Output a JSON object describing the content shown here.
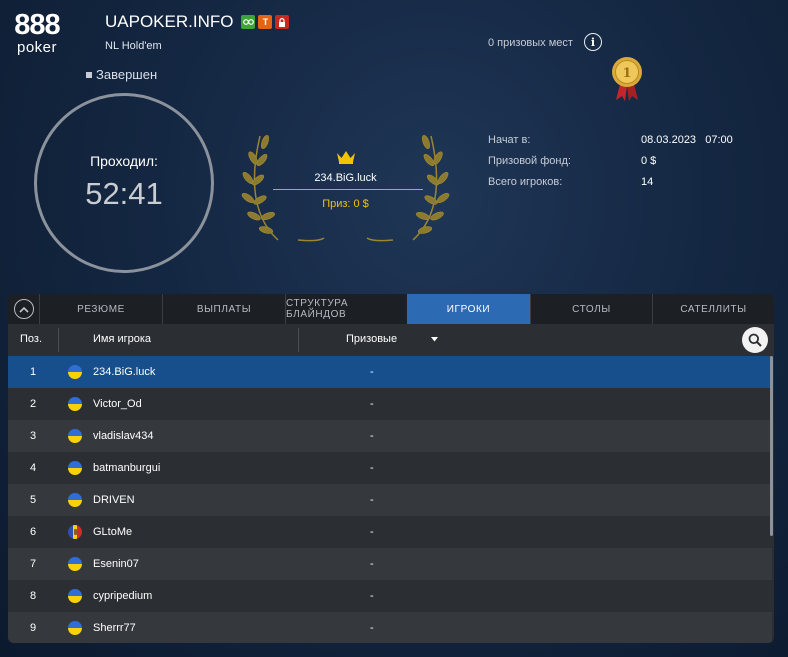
{
  "brand": {
    "logo_top": "888",
    "logo_bottom": "poker"
  },
  "header": {
    "title": "UAPOKER.INFO",
    "badges": [
      "icon-glasses",
      "Т",
      "lock-icon"
    ],
    "game_type": "NL Hold'em",
    "status": "Завершен"
  },
  "timer": {
    "label": "Проходил:",
    "value": "52:41"
  },
  "winner": {
    "name": "234.BiG.luck",
    "prize": "Приз: 0 $"
  },
  "prize_places": "0 призовых мест",
  "details": {
    "started_label": "Начат в:",
    "started_value": "08.03.2023   07:00",
    "prize_pool_label": "Призовой фонд:",
    "prize_pool_value": "0 $",
    "total_players_label": "Всего игроков:",
    "total_players_value": "14"
  },
  "tabs": [
    {
      "label": "РЕЗЮМЕ",
      "active": false
    },
    {
      "label": "ВЫПЛАТЫ",
      "active": false
    },
    {
      "label": "СТРУКТУРА БЛАЙНДОВ",
      "active": false
    },
    {
      "label": "ИГРОКИ",
      "active": true
    },
    {
      "label": "СТОЛЫ",
      "active": false
    },
    {
      "label": "САТЕЛЛИТЫ",
      "active": false
    }
  ],
  "table": {
    "col_pos": "Поз.",
    "col_name": "Имя игрока",
    "col_prize": "Призовые",
    "rows": [
      {
        "pos": "1",
        "flag": "ua",
        "name": "234.BiG.luck",
        "prize": "-"
      },
      {
        "pos": "2",
        "flag": "ua",
        "name": "Victor_Od",
        "prize": "-"
      },
      {
        "pos": "3",
        "flag": "ua",
        "name": "vladislav434",
        "prize": "-"
      },
      {
        "pos": "4",
        "flag": "ua",
        "name": "batmanburgui",
        "prize": "-"
      },
      {
        "pos": "5",
        "flag": "ua",
        "name": "DRIVEN",
        "prize": "-"
      },
      {
        "pos": "6",
        "flag": "md",
        "name": "GLtoMe",
        "prize": "-"
      },
      {
        "pos": "7",
        "flag": "ua",
        "name": "Esenin07",
        "prize": "-"
      },
      {
        "pos": "8",
        "flag": "ua",
        "name": "cypripedium",
        "prize": "-"
      },
      {
        "pos": "9",
        "flag": "ua",
        "name": "Sherrr77",
        "prize": "-"
      }
    ]
  },
  "colors": {
    "accent_blue": "#2d6ab4",
    "selected_row": "#174f8c",
    "gold": "#f2c300",
    "ua_blue": "#2f6ed6",
    "ua_yellow": "#f7d20a"
  }
}
